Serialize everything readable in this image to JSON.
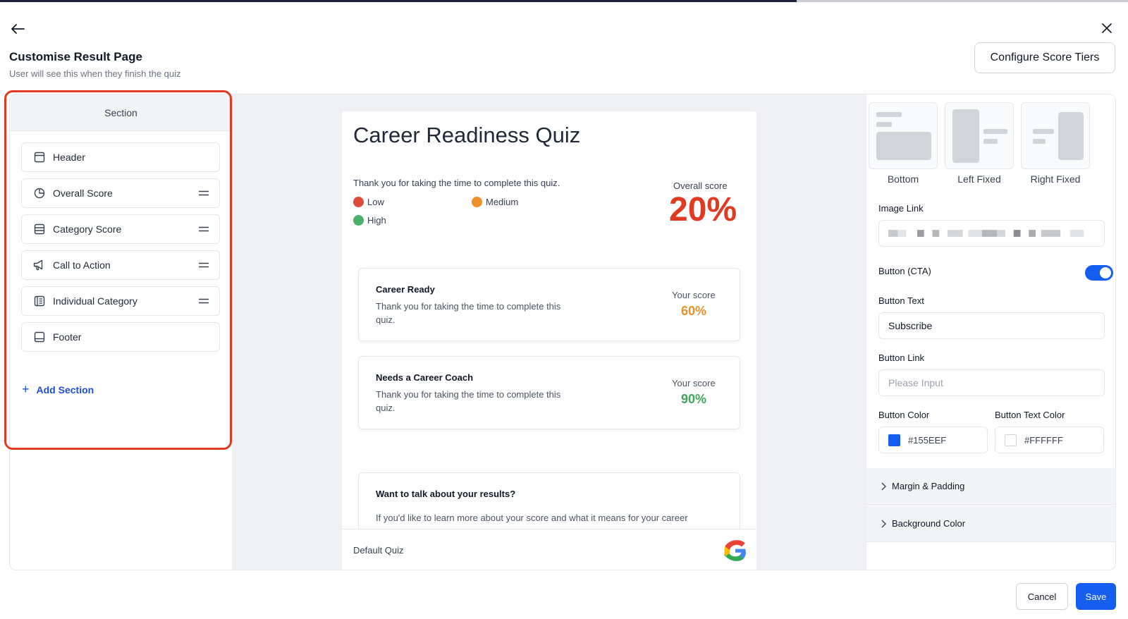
{
  "header": {
    "title": "Customise Result Page",
    "subtitle": "User will see this when they finish the quiz",
    "configure_button": "Configure Score Tiers"
  },
  "sidebar": {
    "heading": "Section",
    "items": [
      {
        "label": "Header",
        "icon": "layout-header-icon",
        "draggable": false
      },
      {
        "label": "Overall Score",
        "icon": "pie-chart-icon",
        "draggable": true
      },
      {
        "label": "Category Score",
        "icon": "list-table-icon",
        "draggable": true
      },
      {
        "label": "Call to Action",
        "icon": "megaphone-icon",
        "draggable": true
      },
      {
        "label": "Individual Category",
        "icon": "document-list-icon",
        "draggable": true
      },
      {
        "label": "Footer",
        "icon": "layout-footer-icon",
        "draggable": false
      }
    ],
    "add_section": "Add Section"
  },
  "preview": {
    "quiz_title": "Career Readiness Quiz",
    "thanks": "Thank you for taking the time to complete this quiz.",
    "legend": [
      {
        "label": "Low",
        "color": "#e04a3a"
      },
      {
        "label": "Medium",
        "color": "#ef8f2a"
      },
      {
        "label": "High",
        "color": "#4caf6a"
      }
    ],
    "overall_label": "Overall score",
    "overall_value": "20%",
    "results": [
      {
        "title": "Career Ready",
        "desc": "Thank you for taking the time to complete this quiz.",
        "score_label": "Your score",
        "score": "60%",
        "color": "#e8912d"
      },
      {
        "title": "Needs a Career Coach",
        "desc": "Thank you for taking the time to complete this quiz.",
        "score_label": "Your score",
        "score": "90%",
        "color": "#3fa65c"
      }
    ],
    "cta_title": "Want to talk about your results?",
    "cta_desc": "If you'd like to learn more about your score and what it means for your career",
    "footer_text": "Default Quiz"
  },
  "settings": {
    "layouts": [
      {
        "label": "Bottom"
      },
      {
        "label": "Left Fixed"
      },
      {
        "label": "Right Fixed"
      }
    ],
    "image_link_label": "Image Link",
    "button_cta_label": "Button (CTA)",
    "button_cta_enabled": true,
    "button_text_label": "Button Text",
    "button_text_value": "Subscribe",
    "button_link_label": "Button Link",
    "button_link_placeholder": "Please Input",
    "button_color_label": "Button Color",
    "button_color_value": "#155EEF",
    "button_text_color_label": "Button Text Color",
    "button_text_color_value": "#FFFFFF",
    "accordions": [
      "Margin & Padding",
      "Background Color"
    ]
  },
  "footer": {
    "cancel": "Cancel",
    "save": "Save"
  },
  "colors": {
    "accent": "#155eef",
    "highlight": "#e03a22",
    "overall_score": "#e03a22"
  }
}
